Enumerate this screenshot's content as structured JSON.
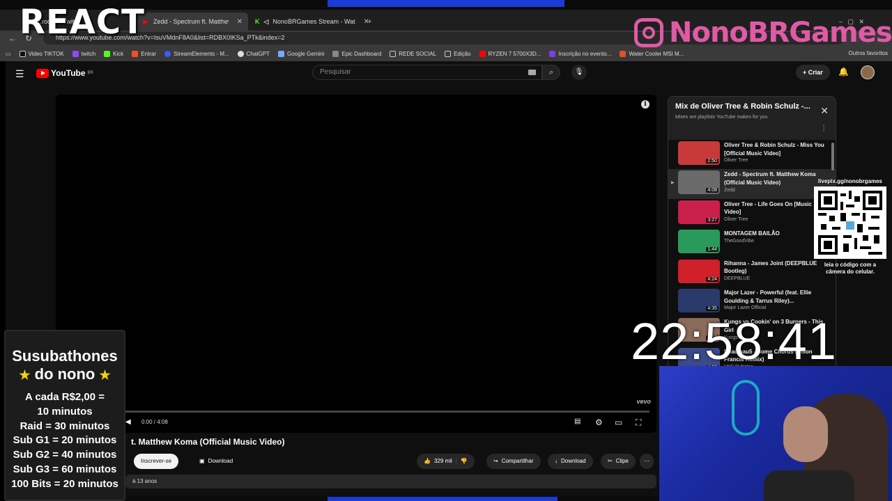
{
  "browser": {
    "tabs": [
      {
        "label": "..roduz - Twitch",
        "icon": "twitch-icon",
        "color": "#9146ff",
        "active": false
      },
      {
        "label": "Zedd - Spectrum ft. Matthew Kom",
        "icon": "youtube-icon",
        "color": "#ff0000",
        "active": true
      },
      {
        "label": "NonoBRGames Stream - Wat",
        "icon": "kick-icon",
        "color": "#53fc18",
        "active": false
      }
    ],
    "url": "https://www.youtube.com/watch?v=IsuVMdnF8A0&list=RDBX0IKSa_PTk&index=2",
    "bookmarks": [
      "Video TIKTOK",
      "twitch",
      "Kick",
      "Entrar",
      "StreamElements - M...",
      "ChatGPT",
      "Google Gemini",
      "Epic Dashboard",
      "REDE SOCIAL",
      "Edição",
      "RYZEN 7 5700X3D...",
      "Inscrição no evento...",
      "Water Cooler MSI M..."
    ],
    "bookmarks_right": "Outros favoritos"
  },
  "overlay": {
    "react_title": "REACT",
    "brand": "NonoBRGames",
    "timer": "22:58:41",
    "qr_label": "livepix.gg/nonobrgames",
    "qr_caption": "leia o código com a câmera do celular.",
    "subathon_title": "Susubathones",
    "subathon_sub": "do nono",
    "subathon_rules": [
      "A cada R$2,00 =",
      "10 minutos",
      "Raid = 30 minutos",
      "Sub G1 = 20 minutos",
      "Sub G2 = 40 minutos",
      "Sub G3 = 60 minutos",
      "100 Bits = 20 minutos"
    ]
  },
  "youtube": {
    "logo": "YouTube",
    "logo_region": "BR",
    "search_placeholder": "Pesquisar",
    "create_label": "Criar",
    "video": {
      "title_fragment": "t. Matthew Koma (Official Music Video)",
      "time": "0:00 / 4:08",
      "watermark": "vevo",
      "progress_fraction": 0
    },
    "actions": {
      "subscribe": "Inscrever-se",
      "download_left": "Download",
      "likes": "329 mil",
      "share": "Compartilhar",
      "download": "Download",
      "clip": "Clipe"
    },
    "description_fragment": "á 13 anos",
    "playlist": {
      "title": "Mix de Oliver Tree & Robin Schulz -...",
      "subtitle": "Mixes are playlists YouTube makes for you",
      "items": [
        {
          "title": "Oliver Tree & Robin Schulz - Miss You [Official Music Video]",
          "channel": "Oliver Tree",
          "duration": "2:50",
          "color": "#c83a3a"
        },
        {
          "title": "Zedd - Spectrum ft. Matthew Koma (Official Music Video)",
          "channel": "Zedd",
          "duration": "4:08",
          "color": "#6a6a6a",
          "current": true
        },
        {
          "title": "Oliver Tree - Life Goes On [Music Video]",
          "channel": "Oliver Tree",
          "duration": "3:27",
          "color": "#c8204a"
        },
        {
          "title": "MONTAGEM BAILÃO",
          "channel": "TheGoodVibe",
          "duration": "1:44",
          "color": "#2a9a5a"
        },
        {
          "title": "Rihanna - James Joint (DEEPBLUE Bootleg)",
          "channel": "DEEPBLUE",
          "duration": "4:24",
          "color": "#d0202a"
        },
        {
          "title": "Major Lazer - Powerful (feat. Ellie Goulding & Tarrus Riley)...",
          "channel": "Major Lazer Official",
          "duration": "4:35",
          "color": "#2a3a6a"
        },
        {
          "title": "Kungs vs Cookin' on 3 Burners - This Girl",
          "channel": "Kungs",
          "duration": "3:18",
          "color": "#8a6a5a"
        },
        {
          "title": "Deadmau5 - Some Chords (Dillon Francis Remix)",
          "channel": "UKF Dubstep",
          "duration": "4:53",
          "color": "#3a4a8a"
        }
      ]
    }
  }
}
